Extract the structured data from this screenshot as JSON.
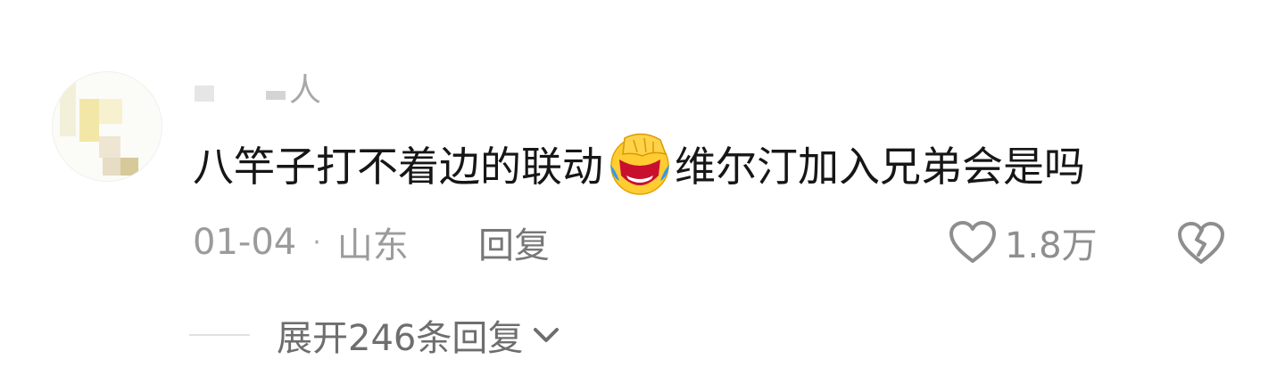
{
  "comment": {
    "username_suffix": "人",
    "text_before_emoji": "八竿子打不着边的联动",
    "emoji": "facepalm-laugh-emoji",
    "text_after_emoji": "维尔汀加入兄弟会是吗",
    "date": "01-04",
    "separator": "·",
    "location": "山东",
    "reply_label": "回复",
    "like_count": "1.8万",
    "expand_label": "展开246条回复"
  },
  "colors": {
    "text_primary": "#161616",
    "text_meta": "#9b9b9b",
    "text_secondary": "#6e6e6e",
    "icon": "#8e8e8e",
    "emoji_face": "#ffcc33",
    "emoji_tear": "#2f9bea"
  }
}
